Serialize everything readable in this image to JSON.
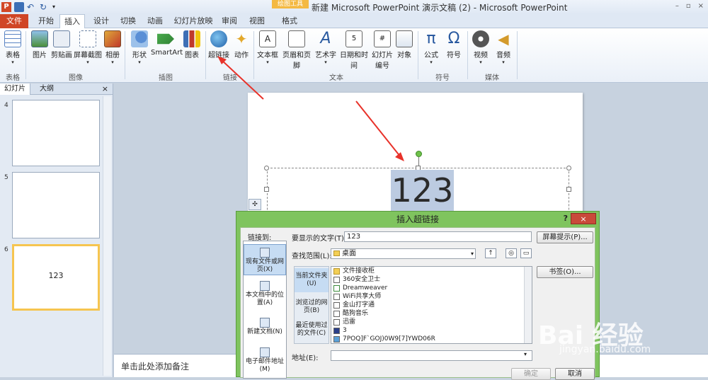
{
  "titlebar": {
    "app_icon": "P",
    "context_tools": "绘图工具",
    "title": "新建 Microsoft PowerPoint 演示文稿 (2)  -  Microsoft PowerPoint",
    "window_controls": [
      "–",
      "▫",
      "×"
    ]
  },
  "tabs": [
    "文件",
    "开始",
    "插入",
    "设计",
    "切换",
    "动画",
    "幻灯片放映",
    "审阅",
    "视图",
    "格式"
  ],
  "ribbon": {
    "buttons": [
      "表格",
      "图片",
      "剪贴画",
      "屏幕截图",
      "相册",
      "形状",
      "SmartArt",
      "图表",
      "超链接",
      "动作",
      "文本框",
      "页眉和页脚",
      "艺术字",
      "日期和时间",
      "幻灯片编号",
      "对象",
      "公式",
      "符号",
      "视频",
      "音频"
    ],
    "groups": [
      "表格",
      "图像",
      "插图",
      "链接",
      "文本",
      "符号",
      "媒体"
    ]
  },
  "left_panel": {
    "tabs": [
      "幻灯片",
      "大纲"
    ],
    "close": "×",
    "slides": [
      {
        "number": "4",
        "text": ""
      },
      {
        "number": "5",
        "text": ""
      },
      {
        "number": "6",
        "text": "123"
      }
    ]
  },
  "slide": {
    "selected_text": "123",
    "notes_placeholder": "单击此处添加备注"
  },
  "dialog": {
    "title": "插入超链接",
    "help": "?",
    "close": "×",
    "link_to_label": "链接到:",
    "link_to_items": [
      "现有文件或网页(X)",
      "本文档中的位置(A)",
      "新建文档(N)",
      "电子邮件地址(M)"
    ],
    "text_to_display_label": "要显示的文字(T):",
    "text_to_display_value": "123",
    "screentip_button": "屏幕提示(P)...",
    "look_in_label": "查找范围(L):",
    "look_in_value": "桌面",
    "bookmark_button": "书签(O)...",
    "side_items": [
      "当前文件夹(U)",
      "浏览过的网页(B)",
      "最近使用过的文件(C)"
    ],
    "files": [
      "文件接收柜",
      "360安全卫士",
      "Dreamweaver",
      "WiFi共享大师",
      "金山打字通",
      "酷狗音乐",
      "迅雷",
      "3",
      "7POQ]F`GOJ)0W9[7]YWD06R"
    ],
    "address_label": "地址(E):",
    "address_value": "",
    "ok_button": "确定",
    "cancel_button": "取消"
  },
  "watermark": {
    "text": "Bai 经验",
    "subtext": "jingyan.baidu.com"
  }
}
